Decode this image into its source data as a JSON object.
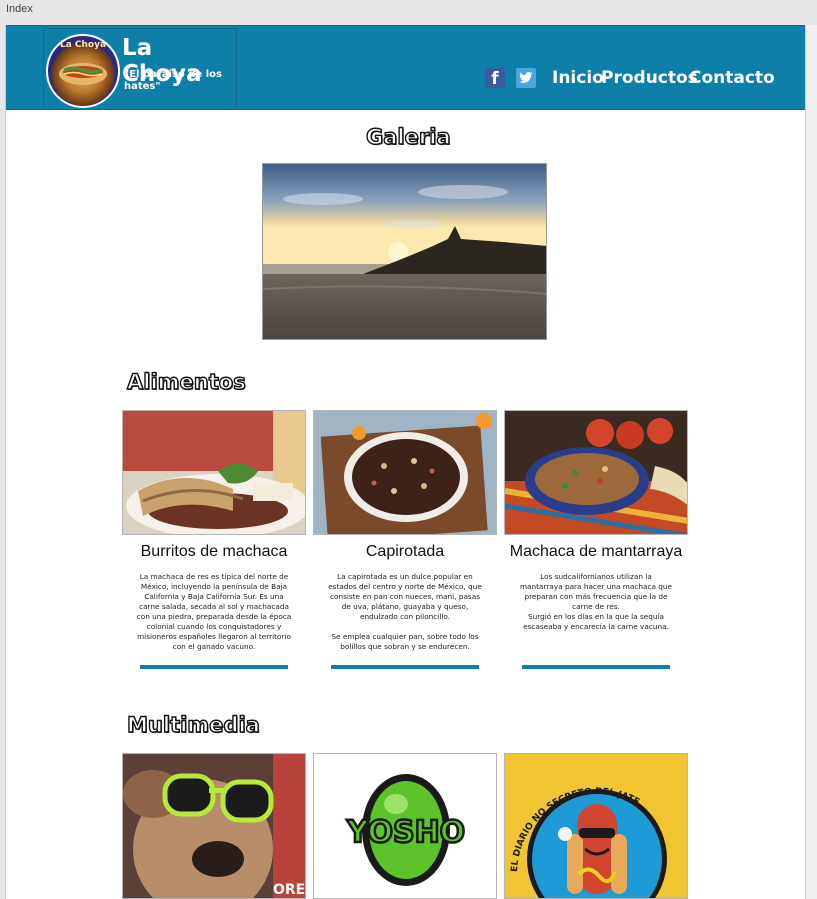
{
  "tab": {
    "title": "Index"
  },
  "header": {
    "logo_ring_text": "La Choya",
    "logo_title": "La Choya",
    "logo_slogan": "\"El paraiso de los hates\"",
    "social": [
      {
        "name": "facebook",
        "glyph": "f"
      },
      {
        "name": "twitter",
        "glyph": "t"
      }
    ],
    "nav": [
      {
        "label": "Inicio"
      },
      {
        "label": "Productos"
      },
      {
        "label": "Contacto"
      }
    ],
    "colors": {
      "bar": "#0e7fa8",
      "text": "#ffffff"
    }
  },
  "gallery": {
    "heading": "Galeria"
  },
  "foods": {
    "heading": "Alimentos",
    "items": [
      {
        "title": "Burritos de machaca",
        "description": "La machaca de res es típica del norte de México, incluyendo la península de Baja California y Baja California Sur. Es una carne salada, secada al sol y machacada con una piedra, preparada desde la época colonial cuando los conquistadores y misioneros españoles llegaron al territorio con el ganado vacuno."
      },
      {
        "title": "Capirotada",
        "description": "La capirotada es un dulce popular en estados del centro y norte de México, que  consiste en pan con nueces, mani, pasas de uva, plátano, guayaba y queso, endulzado con piloncillo.\n\nSe emplea cualquier pan, sobre todo los bolillos que sobran y se endurecen."
      },
      {
        "title": "Machaca de mantarraya",
        "description": "Los sudcalifornianos utilizan la mantarraya para hacer una machaca que preparan con más frecuencia que la de carne de res.\nSurgió en los días en la que la sequía escaseaba y encarecía la carne vacuna."
      }
    ],
    "accent": "#0e7fa8"
  },
  "multimedia": {
    "heading": "Multimedia",
    "items": [
      {
        "name": "dog-with-sunglasses"
      },
      {
        "name": "yosho-logo",
        "label": "YOSHO"
      },
      {
        "name": "hotdog-logo",
        "label": "EL DIARIO NO SECRETO DEL JATE"
      }
    ]
  }
}
